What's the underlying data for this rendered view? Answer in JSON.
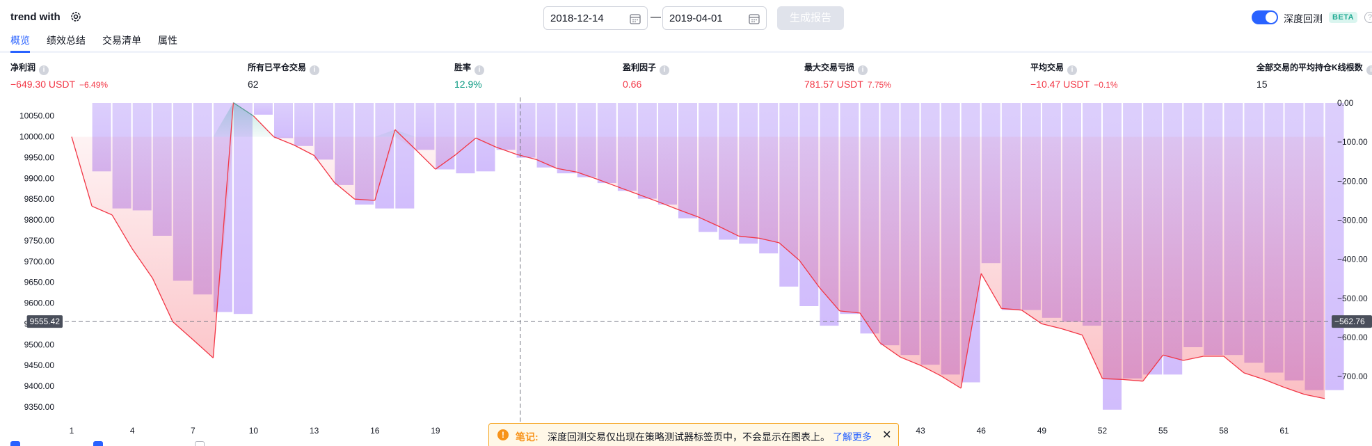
{
  "header": {
    "strategy_name": "trend with",
    "start_date": "2018-12-14",
    "date_separator": "—",
    "end_date": "2019-04-01",
    "generate_label": "生成报告",
    "deep_backtest_label": "深度回测",
    "beta_label": "BETA",
    "help_glyph": "?"
  },
  "tabs": [
    {
      "label": "概览",
      "active": true
    },
    {
      "label": "绩效总结",
      "active": false
    },
    {
      "label": "交易清单",
      "active": false
    },
    {
      "label": "属性",
      "active": false
    }
  ],
  "metrics": {
    "net_profit": {
      "label": "净利润",
      "value": "−649.30 USDT",
      "pct": "−6.49%"
    },
    "closed_trades": {
      "label": "所有已平仓交易",
      "value": "62"
    },
    "win_rate": {
      "label": "胜率",
      "value": "12.9%"
    },
    "profit_factor": {
      "label": "盈利因子",
      "value": "0.66"
    },
    "max_drawdown": {
      "label": "最大交易亏损",
      "value": "781.57 USDT",
      "pct": "7.75%"
    },
    "avg_trade": {
      "label": "平均交易",
      "value": "−10.47 USDT",
      "pct": "−0.1%"
    },
    "avg_bars": {
      "label": "全部交易的平均持仓K线根数",
      "value": "15"
    }
  },
  "notice": {
    "title": "笔记:",
    "text": "深度回测交易仅出现在策略测试器标签页中，不会显示在图表上。",
    "link": "了解更多",
    "close": "✕"
  },
  "colors": {
    "accent": "#2962ff",
    "loss": "#f23645",
    "gain": "#089981",
    "drawdown_bar": "#c9b1fb",
    "equity_line_loss": "#f23645",
    "equity_line_gain": "#5b9e94"
  },
  "chart_data": {
    "type": "area",
    "title": "",
    "xlabel": "",
    "ylabel_left": "",
    "ylabel_right": "",
    "baseline": 10000,
    "left_ylim": [
      9330,
      10080
    ],
    "right_ylim": [
      -780,
      0
    ],
    "left_ticks": [
      "10050.00",
      "10000.00",
      "9950.00",
      "9900.00",
      "9850.00",
      "9800.00",
      "9750.00",
      "9700.00",
      "9650.00",
      "9600.00",
      "9550.00",
      "9500.00",
      "9450.00",
      "9400.00",
      "9350.00"
    ],
    "right_ticks": [
      "0.00",
      "−100.00",
      "−200.00",
      "−300.00",
      "−400.00",
      "−500.00",
      "−600.00",
      "−700.00"
    ],
    "x_ticks": [
      "1",
      "4",
      "7",
      "10",
      "13",
      "16",
      "19",
      "43",
      "46",
      "49",
      "52",
      "55",
      "58",
      "61"
    ],
    "crosshair": {
      "left_value": "9555.42",
      "right_value": "−562.76"
    },
    "series": [
      {
        "name": "equity",
        "trade": [
          1,
          2,
          3,
          4,
          5,
          6,
          7,
          8,
          9,
          10,
          11,
          12,
          13,
          14,
          15,
          16,
          17,
          18,
          19,
          20,
          21,
          22,
          23,
          24,
          25,
          26,
          27,
          28,
          29,
          30,
          31,
          32,
          33,
          34,
          35,
          36,
          37,
          38,
          39,
          40,
          41,
          42,
          43,
          44,
          45,
          46,
          47,
          48,
          49,
          50,
          51,
          52,
          53,
          54,
          55,
          56,
          57,
          58,
          59,
          60,
          61,
          62,
          63
        ],
        "values": [
          10000,
          9833,
          9812,
          9730,
          9660,
          9555,
          9512,
          9468,
          10082,
          10050,
          10000,
          9980,
          9955,
          9890,
          9850,
          9847,
          10017,
          9970,
          9922,
          9957,
          9997,
          9975,
          9958,
          9945,
          9924,
          9915,
          9898,
          9880,
          9862,
          9844,
          9825,
          9807,
          9785,
          9761,
          9756,
          9745,
          9703,
          9637,
          9581,
          9576,
          9504,
          9470,
          9450,
          9425,
          9395,
          9671,
          9587,
          9583,
          9550,
          9538,
          9523,
          9418,
          9416,
          9412,
          9475,
          9462,
          9472,
          9472,
          9432,
          9416,
          9397,
          9380,
          9370
        ]
      },
      {
        "name": "drawdown",
        "trade": [
          1,
          2,
          3,
          4,
          5,
          6,
          7,
          8,
          9,
          10,
          11,
          12,
          13,
          14,
          15,
          16,
          17,
          18,
          19,
          20,
          21,
          22,
          23,
          24,
          25,
          26,
          27,
          28,
          29,
          30,
          31,
          32,
          33,
          34,
          35,
          36,
          37,
          38,
          39,
          40,
          41,
          42,
          43,
          44,
          45,
          46,
          47,
          48,
          49,
          50,
          51,
          52,
          53,
          54,
          55,
          56,
          57,
          58,
          59,
          60,
          61,
          62,
          63
        ],
        "values": [
          0,
          -175,
          -270,
          -275,
          -340,
          -455,
          -490,
          -535,
          -540,
          -30,
          -90,
          -110,
          -145,
          -210,
          -260,
          -270,
          -270,
          -120,
          -170,
          -180,
          -175,
          -120,
          -140,
          -165,
          -180,
          -190,
          -205,
          -225,
          -245,
          -260,
          -295,
          -330,
          -350,
          -360,
          -385,
          -470,
          -520,
          -570,
          -540,
          -590,
          -620,
          -645,
          -670,
          -695,
          -715,
          -410,
          -530,
          -530,
          -550,
          -560,
          -570,
          -785,
          -705,
          -695,
          -695,
          -625,
          -645,
          -645,
          -665,
          -690,
          -710,
          -735,
          -735
        ]
      }
    ],
    "grid": false,
    "legend": "none"
  }
}
